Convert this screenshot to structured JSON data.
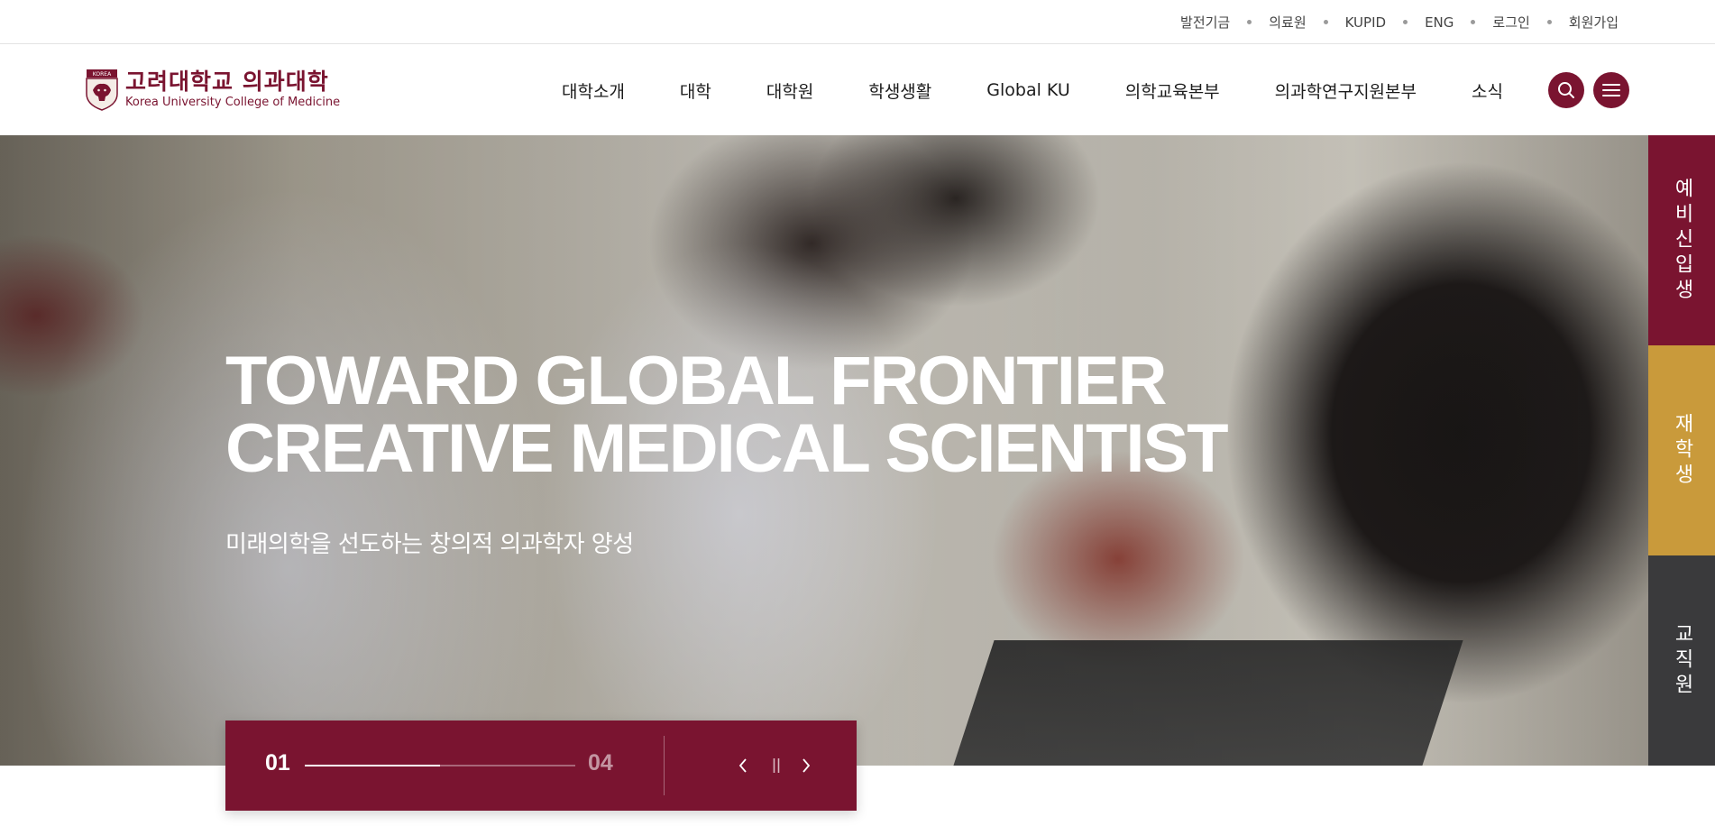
{
  "utility_nav": [
    "발전기금",
    "의료원",
    "KUPID",
    "ENG",
    "로그인",
    "회원가입"
  ],
  "logo": {
    "ko": "고려대학교 의과대학",
    "en": "Korea University College of Medicine",
    "emblem_text": "KOREA"
  },
  "main_nav": [
    "대학소개",
    "대학",
    "대학원",
    "학생생활",
    "Global KU",
    "의학교육본부",
    "의과학연구지원본부",
    "소식"
  ],
  "hero": {
    "title_line1": "TOWARD GLOBAL FRONTIER",
    "title_line2": "CREATIVE MEDICAL SCIENTIST",
    "subtitle": "미래의학을 선도하는 창의적 의과학자 양성"
  },
  "slider": {
    "current": "01",
    "total": "04",
    "progress": 0.5
  },
  "side_tabs": [
    "예비신입생",
    "재학생",
    "교직원"
  ],
  "colors": {
    "brand": "#7a1430",
    "gold": "#c99a3b",
    "dark": "#3a3a3c"
  },
  "icons": {
    "search": "search-icon",
    "menu": "hamburger-menu-icon",
    "prev": "chevron-left-icon",
    "pause": "pause-icon",
    "next": "chevron-right-icon"
  }
}
